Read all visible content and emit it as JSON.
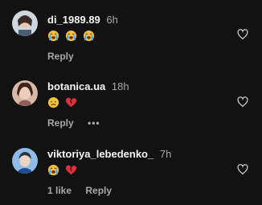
{
  "comments": [
    {
      "username": "di_1989.89",
      "time": "6h",
      "emojis": [
        "loudly-crying-face",
        "loudly-crying-face",
        "loudly-crying-face"
      ],
      "likes": "",
      "reply": "Reply",
      "has_more": false
    },
    {
      "username": "botanica.ua",
      "time": "18h",
      "emojis": [
        "disappointed-face",
        "broken-heart"
      ],
      "likes": "",
      "reply": "Reply",
      "has_more": true,
      "more": "•••"
    },
    {
      "username": "viktoriya_lebedenko_",
      "time": "7h",
      "emojis": [
        "loudly-crying-face",
        "broken-heart"
      ],
      "likes": "1 like",
      "reply": "Reply",
      "has_more": false
    }
  ],
  "colors": {
    "background": "#121212",
    "text": "#f5f5f5",
    "muted": "#a8a8a8"
  }
}
